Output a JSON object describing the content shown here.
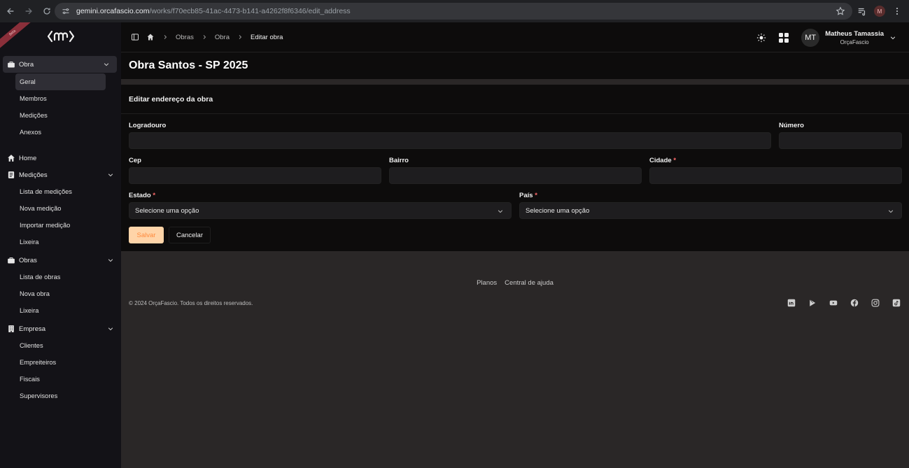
{
  "browser": {
    "url_host": "gemini.orcafascio.com",
    "url_path": "/works/f70ecb85-41ac-4473-b141-a4262f8f6346/edit_address",
    "profile_initial": "M"
  },
  "sidebar": {
    "ribbon_text": "Beta",
    "obra_section": {
      "label": "Obra",
      "items": [
        "Geral",
        "Membros",
        "Medições",
        "Anexos"
      ]
    },
    "home_label": "Home",
    "medicoes_section": {
      "label": "Medições",
      "items": [
        "Lista de medições",
        "Nova medição",
        "Importar medição",
        "Lixeira"
      ]
    },
    "obras_section": {
      "label": "Obras",
      "items": [
        "Lista de obras",
        "Nova obra",
        "Lixeira"
      ]
    },
    "empresa_section": {
      "label": "Empresa",
      "items": [
        "Clientes",
        "Empreiteiros",
        "Fiscais",
        "Supervisores"
      ]
    }
  },
  "breadcrumb": {
    "items": [
      "Obras",
      "Obra"
    ],
    "current": "Editar obra"
  },
  "user": {
    "initials": "MT",
    "name": "Matheus Tamassia",
    "org": "OrçaFascio"
  },
  "page": {
    "title": "Obra Santos - SP 2025"
  },
  "form": {
    "header": "Editar endereço da obra",
    "logradouro_label": "Logradouro",
    "numero_label": "Número",
    "cep_label": "Cep",
    "bairro_label": "Bairro",
    "cidade_label": "Cidade",
    "estado_label": "Estado",
    "pais_label": "País",
    "required_mark": "*",
    "estado_value": "Selecione uma opção",
    "pais_value": "Selecione uma opção",
    "save_label": "Salvar",
    "cancel_label": "Cancelar"
  },
  "footer": {
    "links": [
      "Planos",
      "Central de ajuda"
    ],
    "copyright": "© 2024 OrçaFascio. Todos os direitos reservados.",
    "social_icons": [
      "linkedin-icon",
      "play-icon",
      "youtube-icon",
      "facebook-icon",
      "instagram-icon",
      "tiktok-icon"
    ]
  }
}
